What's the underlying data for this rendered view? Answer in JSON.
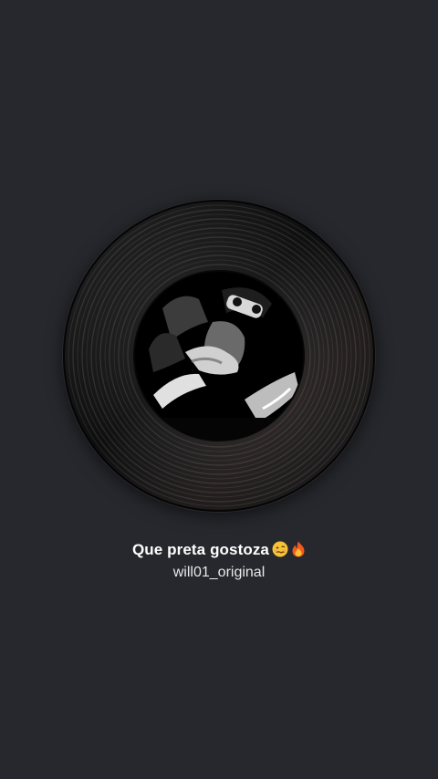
{
  "now_playing": {
    "title": "Que preta gostoza",
    "emojis": [
      "woozy-face-emoji",
      "fire-emoji"
    ],
    "artist": "will01_original"
  },
  "colors": {
    "background": "#27282d",
    "title_text": "#ffffff",
    "artist_text": "#e8e8ea",
    "vinyl": "#151515"
  }
}
